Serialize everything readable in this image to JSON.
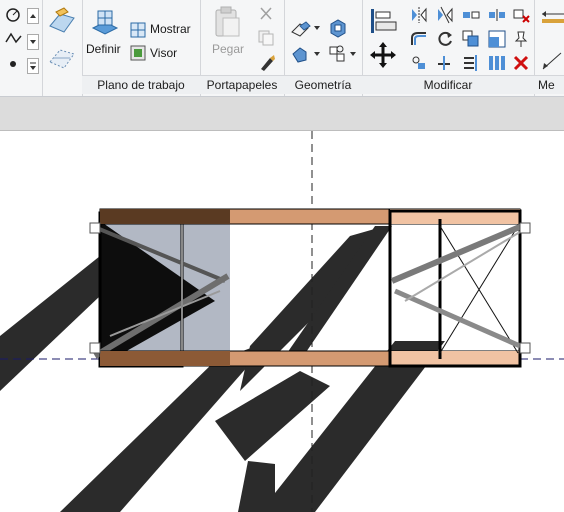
{
  "ribbon": {
    "panels": {
      "plano_trabajo": {
        "title": "Plano de trabajo",
        "definir": "Definir",
        "mostrar": "Mostrar",
        "visor": "Visor"
      },
      "portapapeles": {
        "title": "Portapapeles",
        "pegar": "Pegar"
      },
      "geometria": {
        "title": "Geometría"
      },
      "modificar": {
        "title": "Modificar"
      },
      "next": {
        "title": "Me"
      }
    }
  },
  "colors": {
    "ribbon_bg": "#f5f6f7",
    "band": "#dcdcdc",
    "beam": "#d49a72",
    "beam_dark": "#5a3a22",
    "beam_light": "#f1c3a3",
    "shadow": "#2b2b2b",
    "glass": "#b2b8c4"
  }
}
